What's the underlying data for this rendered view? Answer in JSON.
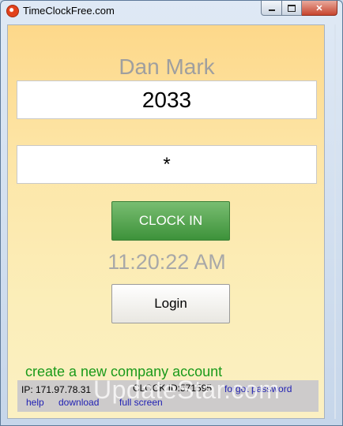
{
  "window": {
    "title": "TimeClockFree.com"
  },
  "form": {
    "user_name": "Dan Mark",
    "employee_id": "2033",
    "pin": "*",
    "clock_in_label": "CLOCK IN",
    "time": "11:20:22 AM",
    "login_label": "Login"
  },
  "links": {
    "create_account": "create a new company account"
  },
  "footer": {
    "ip": "IP: 171.97.78.31",
    "clock_id": "CLOCK ID:571595",
    "forgot_password": "forgot password",
    "help": "help",
    "download": "download",
    "full_screen": "full screen"
  },
  "watermark": "UpdateStar.com",
  "icons": {
    "app": "app-icon",
    "minimize": "minimize-icon",
    "maximize": "maximize-icon",
    "close": "close-icon"
  },
  "colors": {
    "clock_in_green": "#4fa24a",
    "link_green": "#1a9a1a",
    "link_blue": "#1f1fb3",
    "panel_top": "#fdd88a",
    "panel_bottom": "#fbf0c2"
  }
}
